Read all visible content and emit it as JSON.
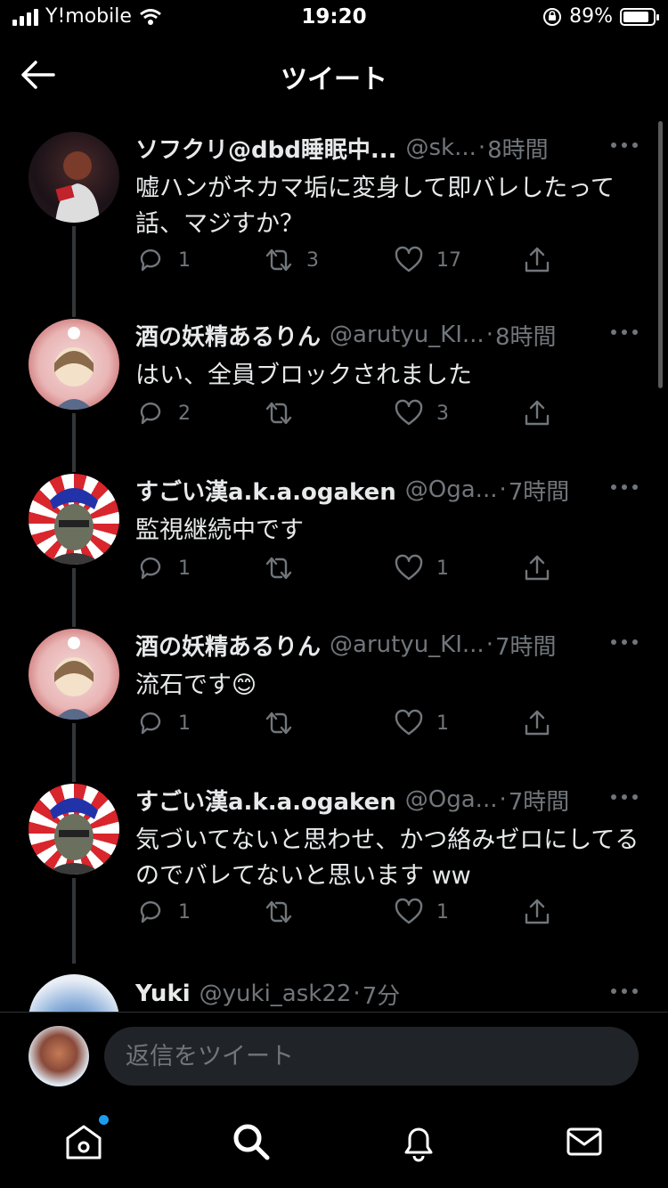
{
  "status_bar": {
    "carrier": "Y!mobile",
    "time": "19:20",
    "battery": "89%",
    "battery_level": 0.89
  },
  "header": {
    "title": "ツイート"
  },
  "tweets": [
    {
      "name": "ソフクリ@dbd睡眠中...",
      "handle": "@sk...",
      "time": "8時間",
      "text": "嘘ハンがネカマ垢に変身して即バレしたって話、マジすか？",
      "replies": "1",
      "retweets": "3",
      "likes": "17"
    },
    {
      "name": "酒の妖精あるりん",
      "handle": "@arutyu_KI...",
      "time": "8時間",
      "text": "はい、全員ブロックされました",
      "replies": "2",
      "retweets": "",
      "likes": "3"
    },
    {
      "name": "すごい漢a.k.a.ogaken",
      "handle": "@Oga...",
      "time": "7時間",
      "text": "監視継続中です",
      "replies": "1",
      "retweets": "",
      "likes": "1"
    },
    {
      "name": "酒の妖精あるりん",
      "handle": "@arutyu_KI...",
      "time": "7時間",
      "text": "流石です😊",
      "replies": "1",
      "retweets": "",
      "likes": "1"
    },
    {
      "name": "すごい漢a.k.a.ogaken",
      "handle": "@Oga...",
      "time": "7時間",
      "text": "気づいてないと思わせ、かつ絡みゼロにしてるのでバレてないと思います ww",
      "replies": "1",
      "retweets": "",
      "likes": "1"
    },
    {
      "name": "Yuki",
      "handle": "@yuki_ask22",
      "time": "7分",
      "text": ""
    }
  ],
  "reply": {
    "placeholder": "返信をツイート"
  },
  "tabs": {
    "home": "home-icon",
    "search": "search-icon",
    "notifications": "bell-icon",
    "messages": "mail-icon"
  },
  "colors": {
    "background": "#000000",
    "muted": "#71767b",
    "accent": "#1d9bf0"
  }
}
